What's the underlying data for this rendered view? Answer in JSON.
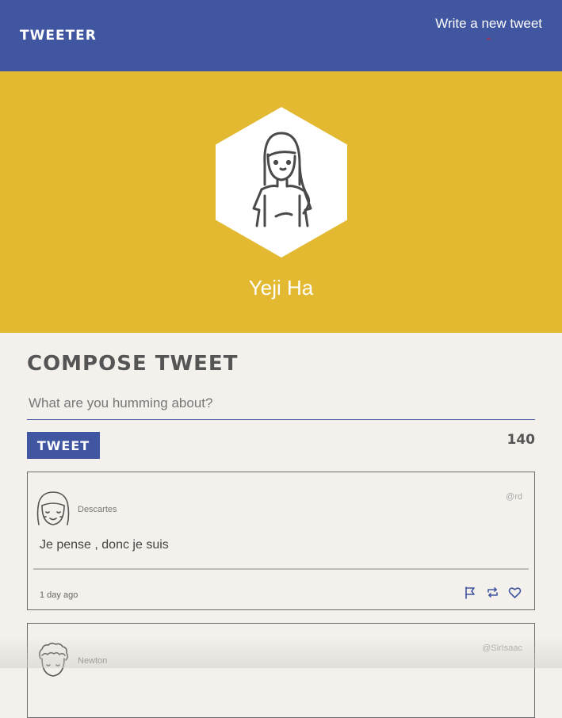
{
  "nav": {
    "brand": "Tweeter",
    "write_label": "Write a new tweet",
    "toggle_icon": "chevron-down-icon"
  },
  "profile": {
    "name": "Yeji Ha",
    "avatar_icon": "girl-avatar-icon"
  },
  "compose": {
    "title": "Compose Tweet",
    "placeholder": "What are you humming about?",
    "button_label": "Tweet",
    "counter": "140"
  },
  "tweets": [
    {
      "name": "Descartes",
      "handle": "@rd",
      "text": "Je pense , donc je suis",
      "time": "1 day ago",
      "avatar_icon": "avatar-icon"
    },
    {
      "name": "Newton",
      "handle": "@SirIsaac",
      "text": "",
      "time": "",
      "avatar_icon": "avatar-icon"
    }
  ],
  "actions": [
    "flag-icon",
    "retweet-icon",
    "heart-icon"
  ],
  "colors": {
    "nav": "#4056a1",
    "profile": "#e3b932",
    "background": "#f4f1ec",
    "accent_red": "#c0304a"
  }
}
